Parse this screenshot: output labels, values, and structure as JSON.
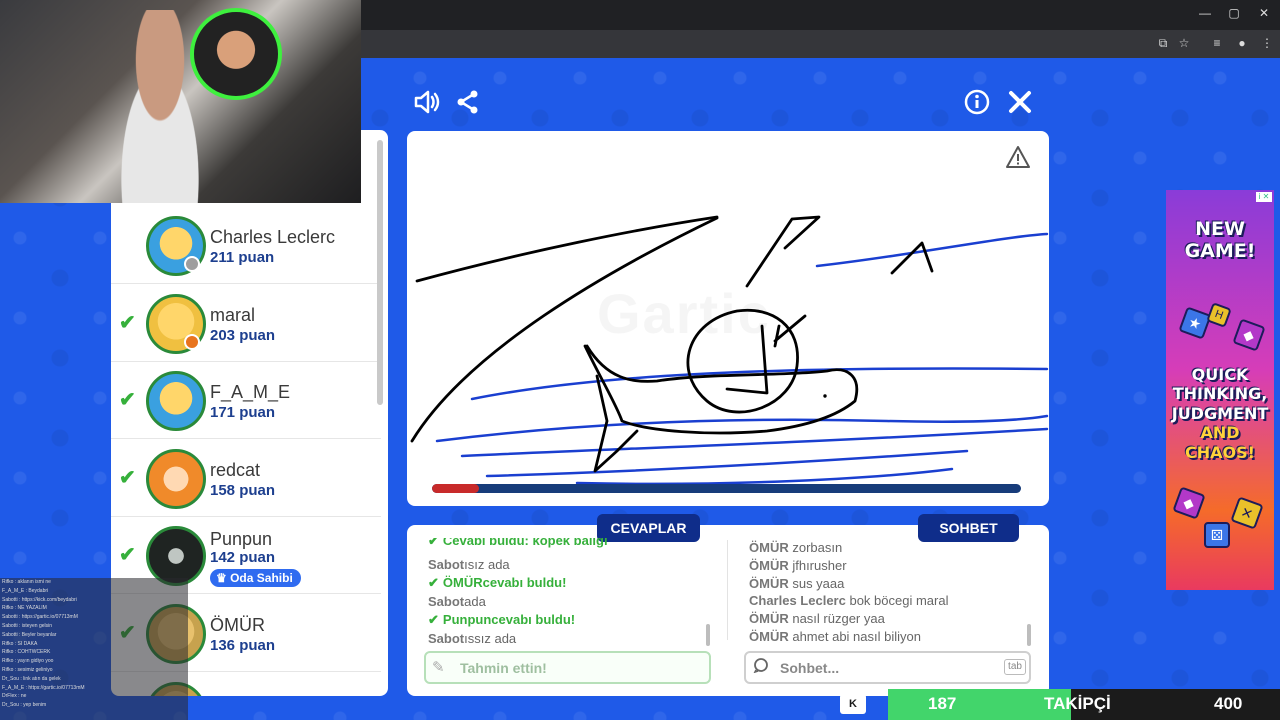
{
  "browser": {
    "window_controls": [
      "—",
      "▢",
      "✕"
    ],
    "toolbar_icons": [
      "⧉",
      "☆",
      "≡",
      "●",
      "⋮"
    ]
  },
  "top_bar": {
    "sound_icon": "speaker-icon",
    "share_icon": "share-icon",
    "info_icon": "info-icon",
    "close_icon": "close-icon"
  },
  "players": [
    {
      "name": "Charles Leclerc",
      "score": "211 puan",
      "guessed": false,
      "status_color": "#9e9e9e"
    },
    {
      "name": "maral",
      "score": "203 puan",
      "guessed": true,
      "status_color": "#e8741e"
    },
    {
      "name": "F_A_M_E",
      "score": "171 puan",
      "guessed": true,
      "status_color": ""
    },
    {
      "name": "redcat",
      "score": "158 puan",
      "guessed": true,
      "status_color": ""
    },
    {
      "name": "Punpun",
      "score": "142 puan",
      "guessed": true,
      "badge": "Oda Sahibi",
      "status_color": ""
    },
    {
      "name": "ÖMÜR",
      "score": "136 puan",
      "guessed": true,
      "status_color": ""
    }
  ],
  "canvas": {
    "watermark": "Gartic",
    "timer_progress": 0.08
  },
  "tabs": {
    "answers": "CEVAPLAR",
    "chat": "SOHBET"
  },
  "answers_feed": [
    {
      "type": "correct",
      "who": "",
      "text": "Cevabı buldu: köpek balığı"
    },
    {
      "type": "msg",
      "who": "Sabot",
      "text": "ısız ada"
    },
    {
      "type": "correct",
      "who": "ÖMÜR",
      "text": "cevabı buldu!"
    },
    {
      "type": "msg",
      "who": "Sabot",
      "text": "ada"
    },
    {
      "type": "correct",
      "who": "Punpun",
      "text": "cevabı buldu!"
    },
    {
      "type": "msg",
      "who": "Sabot",
      "text": "ıssız ada"
    }
  ],
  "chat_feed": [
    {
      "who": "ÖMÜR",
      "text": "zorbasın"
    },
    {
      "who": "ÖMÜR",
      "text": "jfhırusher"
    },
    {
      "who": "ÖMÜR",
      "text": "sus yaaa"
    },
    {
      "who": "Charles Leclerc",
      "text": "bok böcegi maral"
    },
    {
      "who": "ÖMÜR",
      "text": "nasıl rüzger yaa"
    },
    {
      "who": "ÖMÜR",
      "text": "ahmet abi nasıl biliyon"
    }
  ],
  "inputs": {
    "guess_placeholder": "Tahmin ettin!",
    "chat_placeholder": "Sohbet...",
    "tab_key": "tab"
  },
  "ad": {
    "lines": [
      "NEW",
      "GAME!",
      "QUICK",
      "THINKING,",
      "JUDGMENT",
      "AND",
      "CHAOS!"
    ],
    "mark": "i ✕"
  },
  "follower_goal": {
    "logo": "K",
    "current": "187",
    "label": "TAKİPÇİ",
    "goal": "400",
    "progress": 0.4675
  },
  "stream_chat": [
    "Rifko : aklanın ismi ne",
    "F_A_M_E : Beydabri",
    "Sabotti : https://kick.com/beydabri",
    "Rifko : NE YAZALIM",
    "Sabotti : https://gartic.io/07713mM",
    "Sabotti : isteyen gelsin",
    "Sabotti : Beyler beyanlar",
    "Rifko : SI DAKA",
    "Rifko : COHTWCERK",
    "Rifko : yayın gidiyo yoo",
    "Rifko : sesimiz geliniyo",
    "Dr_Sou : link atın da gelek",
    "F_A_M_E : https://gartic.io/07713mM",
    "DrFlex : ne",
    "Dr_Sou : yep benim"
  ],
  "colors": {
    "page_bg": "#1f5ae8",
    "accent_green": "#36b03b",
    "tab_navy": "#0f2d8a",
    "score_blue": "#1d3f8f"
  }
}
